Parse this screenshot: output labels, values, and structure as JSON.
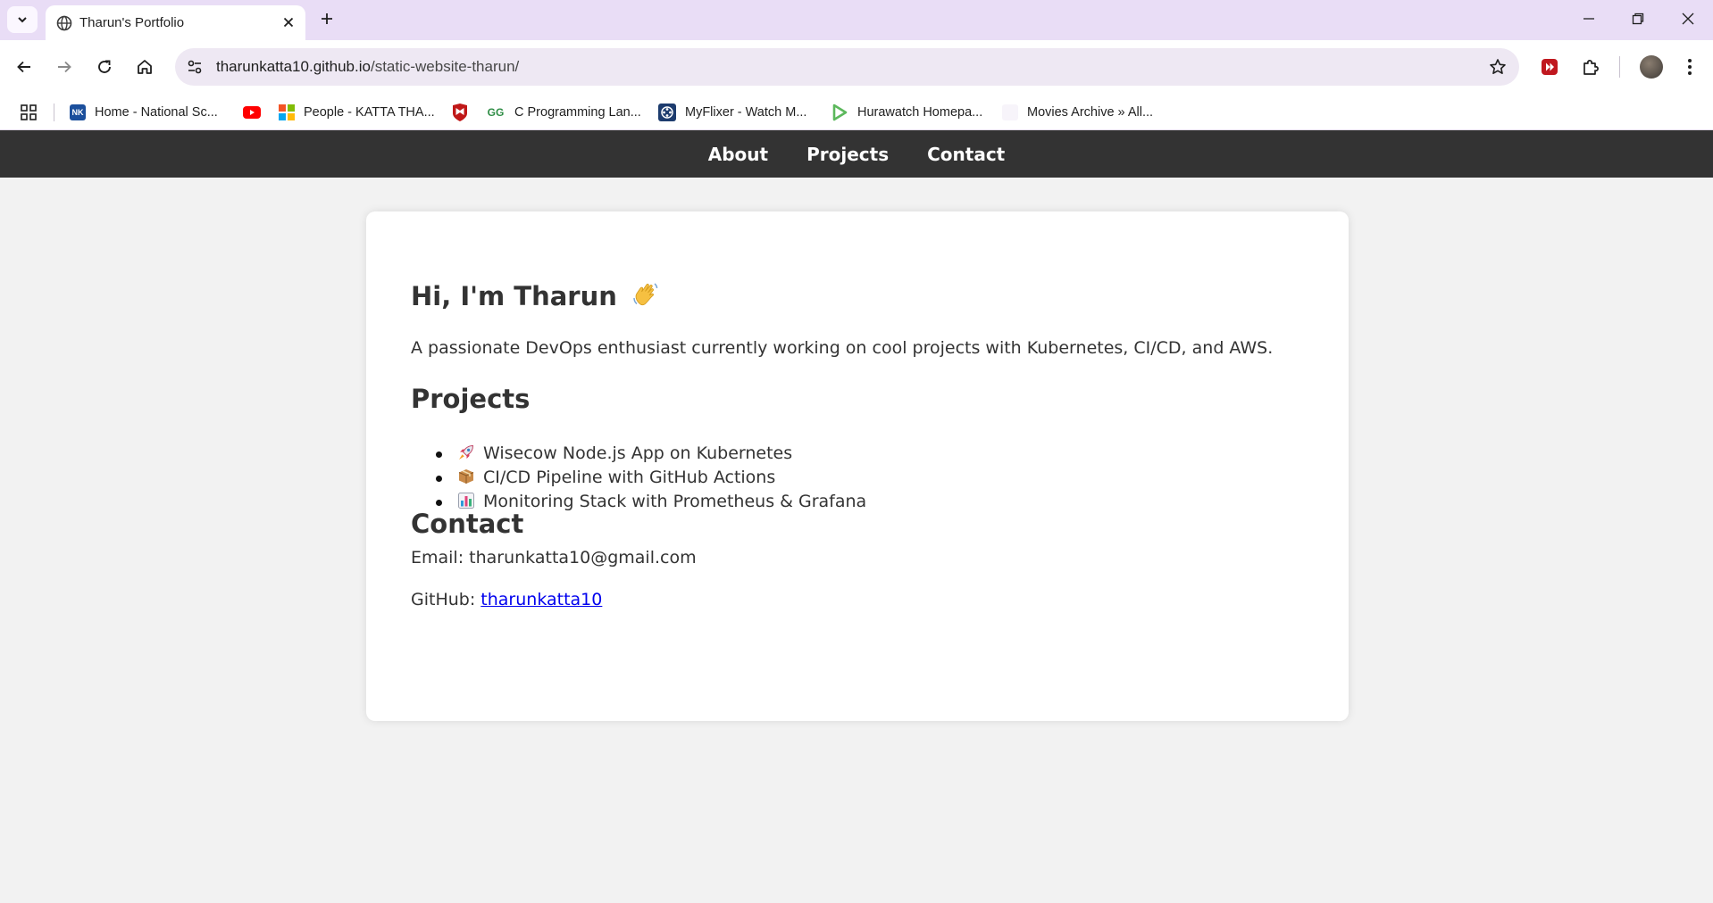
{
  "browser": {
    "tab": {
      "title": "Tharun's Portfolio"
    },
    "url": {
      "host": "tharunkatta10.github.io",
      "path": "/static-website-tharun/"
    },
    "bookmarks": [
      {
        "label": "Home - National Sc...",
        "icon": "nkn-icon",
        "color": "#1b4f9c"
      },
      {
        "label": "",
        "icon": "youtube-icon",
        "color": "#ff0000"
      },
      {
        "label": "People - KATTA THA...",
        "icon": "microsoft-icon",
        "color": "#f35325"
      },
      {
        "label": "",
        "icon": "mcafee-icon",
        "color": "#c01818"
      },
      {
        "label": "C Programming Lan...",
        "icon": "gfg-icon",
        "color": "#2f8d46"
      },
      {
        "label": "MyFlixer - Watch M...",
        "icon": "film-reel-icon",
        "color": "#1d3c6e"
      },
      {
        "label": "Hurawatch Homepa...",
        "icon": "play-icon",
        "color": "#5cb85c"
      },
      {
        "label": "Movies Archive » All...",
        "icon": "blank-page-icon",
        "color": "#f5f5f5"
      }
    ]
  },
  "nav": {
    "about": "About",
    "projects": "Projects",
    "contact": "Contact"
  },
  "hero": {
    "heading": "Hi, I'm Tharun",
    "emoji": "waving-hand-emoji",
    "intro": "A passionate DevOps enthusiast currently working on cool projects with Kubernetes, CI/CD, and AWS."
  },
  "projects": {
    "heading": "Projects",
    "items": [
      {
        "emoji": "rocket-emoji",
        "text": "Wisecow Node.js App on Kubernetes"
      },
      {
        "emoji": "package-emoji",
        "text": "CI/CD Pipeline with GitHub Actions"
      },
      {
        "emoji": "bar-chart-emoji",
        "text": "Monitoring Stack with Prometheus & Grafana"
      }
    ]
  },
  "contact": {
    "heading": "Contact",
    "email_label": "Email: ",
    "email": "tharunkatta10@gmail.com",
    "github_label": "GitHub: ",
    "github_link": "tharunkatta10"
  }
}
